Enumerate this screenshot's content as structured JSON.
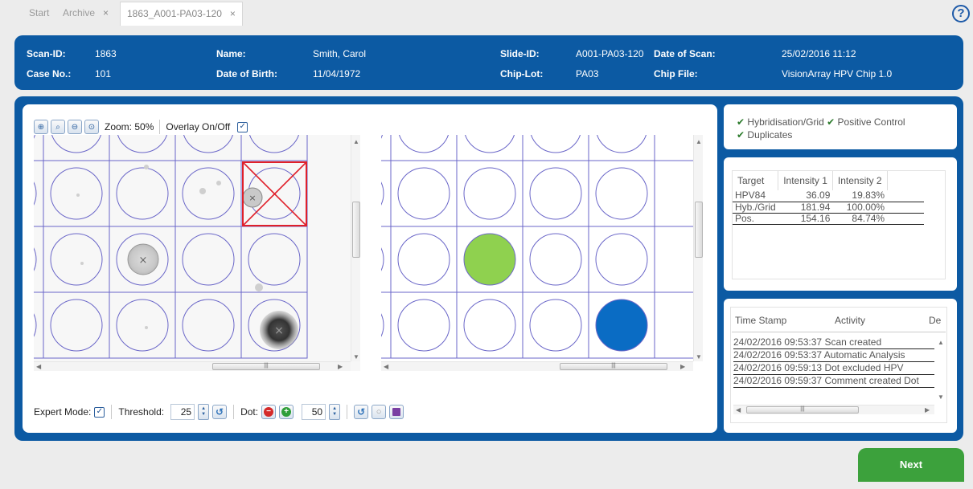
{
  "tabs": [
    {
      "label": "Start",
      "closable": false
    },
    {
      "label": "Archive",
      "closable": true
    },
    {
      "label": "1863_A001-PA03-120",
      "closable": true,
      "active": true
    }
  ],
  "tab_close_glyph": "×",
  "help": {
    "icon": "help-icon",
    "glyph": "?"
  },
  "header": {
    "scan_id_label": "Scan-ID:",
    "scan_id": "1863",
    "case_no_label": "Case No.:",
    "case_no": "101",
    "name_label": "Name:",
    "name": "Smith, Carol",
    "dob_label": "Date of Birth:",
    "dob": "11/04/1972",
    "slide_id_label": "Slide-ID:",
    "slide_id": "A001-PA03-120",
    "chip_lot_label": "Chip-Lot:",
    "chip_lot": "PA03",
    "date_of_scan_label": "Date of Scan:",
    "date_of_scan": "25/02/2016 11:12",
    "chip_file_label": "Chip File:",
    "chip_file": "VisionArray HPV Chip 1.0"
  },
  "toolbar": {
    "zoom_label": "Zoom: 50%",
    "overlay_label": "Overlay On/Off",
    "overlay_checked": true,
    "zoom_buttons": [
      "zoom-in-icon",
      "zoom-fit-icon",
      "zoom-out-icon",
      "zoom-reset-icon"
    ]
  },
  "controls": {
    "expert_mode_label": "Expert Mode:",
    "expert_mode_checked": true,
    "threshold_label": "Threshold:",
    "threshold_value": "25",
    "dot_label": "Dot:",
    "dot_value": "50"
  },
  "qc_checks": [
    {
      "label": "Hybridisation/Grid",
      "passed": true
    },
    {
      "label": "Positive Control",
      "passed": true
    },
    {
      "label": "Duplicates",
      "passed": true
    }
  ],
  "check_glyph": "✔",
  "results": {
    "headers": [
      "Target",
      "Intensity 1",
      "Intensity 2"
    ],
    "rows": [
      [
        "HPV84",
        "36.09",
        "19.83%"
      ],
      [
        "Hyb./Grid",
        "181.94",
        "100.00%"
      ],
      [
        "Pos.",
        "154.16",
        "84.74%"
      ]
    ]
  },
  "log": {
    "headers": [
      "Time Stamp",
      "Activity",
      "De"
    ],
    "rows": [
      "24/02/2016 09:53:37 Scan created",
      "24/02/2016 09:53:37 Automatic Analysis",
      "24/02/2016 09:59:13 Dot excluded        HPV",
      "24/02/2016 09:59:37 Comment created  Dot"
    ]
  },
  "next_label": "Next",
  "colors": {
    "brand_blue": "#0c5aa3",
    "positive_green": "#8fd14f",
    "positive_blue": "#0a6cc4",
    "next_green": "#3ca13c",
    "excluded_red": "#e0202a"
  }
}
